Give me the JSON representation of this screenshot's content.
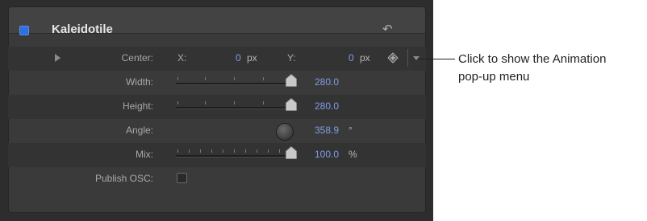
{
  "header": {
    "title": "Kaleidotile"
  },
  "rows": {
    "center": {
      "label": "Center:",
      "x_label": "X:",
      "x_value": "0",
      "x_unit": "px",
      "y_label": "Y:",
      "y_value": "0",
      "y_unit": "px"
    },
    "width": {
      "label": "Width:",
      "value": "280.0",
      "fill": 1.0
    },
    "height": {
      "label": "Height:",
      "value": "280.0",
      "fill": 1.0
    },
    "angle": {
      "label": "Angle:",
      "value": "358.9",
      "unit": "°"
    },
    "mix": {
      "label": "Mix:",
      "value": "100.0",
      "unit": "%",
      "fill": 1.0
    },
    "publish": {
      "label": "Publish OSC:"
    }
  },
  "callout": {
    "line1": "Click to show the Animation",
    "line2": "pop-up menu"
  },
  "colors": {
    "accent": "#2f6fe0",
    "value_text": "#7f9ee6",
    "panel": "#3a3a3a"
  }
}
